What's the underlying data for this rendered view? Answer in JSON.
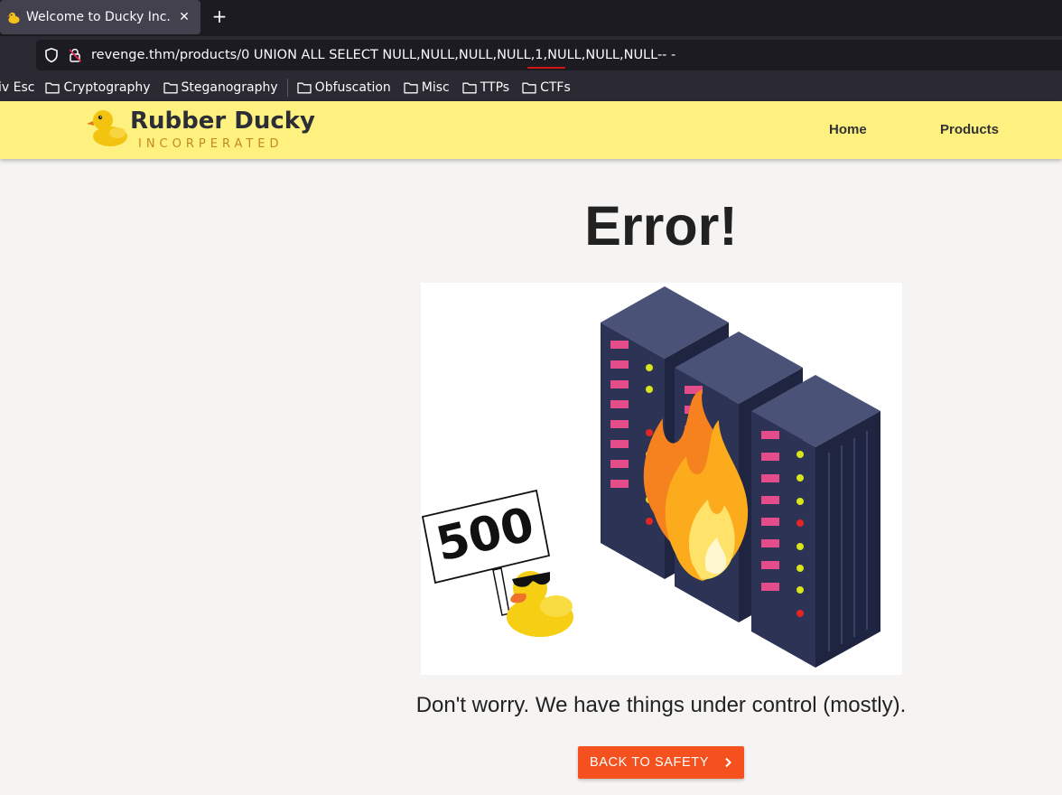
{
  "browser": {
    "tab": {
      "title": "Welcome to Ducky Inc.",
      "favicon": "duck-favicon-icon",
      "close": "✕"
    },
    "new_tab": "+",
    "url": "revenge.thm/products/0 UNION ALL SELECT NULL,NULL,NULL,NULL,1,NULL,NULL,NULL-- -",
    "bookmarks": [
      {
        "label": "iv Esc"
      },
      {
        "label": "Cryptography"
      },
      {
        "label": "Steganography"
      },
      {
        "label": "Obfuscation"
      },
      {
        "label": "Misc"
      },
      {
        "label": "TTPs"
      },
      {
        "label": "CTFs"
      }
    ]
  },
  "site": {
    "logo_title": "Rubber Ducky",
    "logo_subtitle": "INCORPERATED",
    "nav": {
      "home": "Home",
      "products": "Products"
    }
  },
  "main": {
    "title": "Error!",
    "sign_text": "500",
    "message": "Don't worry. We have things under control (mostly).",
    "button": "BACK TO SAFETY",
    "button_icon": "chevron-right-icon"
  },
  "colors": {
    "header_bg": "#fff17f",
    "button_bg": "#f4511e",
    "page_bg": "#f5f4f2",
    "server": "#2c3354"
  }
}
